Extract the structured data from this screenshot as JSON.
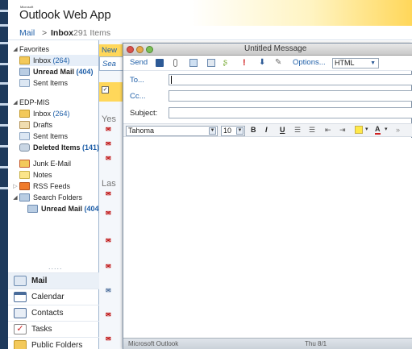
{
  "app": {
    "logo_small": "Microsoft",
    "logo": "Outlook Web App"
  },
  "breadcrumb": {
    "mail": "Mail",
    "sep": ">",
    "folder": "Inbox",
    "count": "291 Items"
  },
  "nav": {
    "favorites_label": "Favorites",
    "favorites": [
      {
        "label": "Inbox",
        "count": "(264)"
      },
      {
        "label": "Unread Mail",
        "count": "(404)"
      },
      {
        "label": "Sent Items",
        "count": ""
      }
    ],
    "account_label": "EDP-MIS",
    "folders": [
      {
        "label": "Inbox",
        "count": "(264)"
      },
      {
        "label": "Drafts",
        "count": ""
      },
      {
        "label": "Sent Items",
        "count": ""
      },
      {
        "label": "Deleted Items",
        "count": "(141)"
      },
      {
        "label": "Junk E-Mail",
        "count": ""
      },
      {
        "label": "Notes",
        "count": ""
      },
      {
        "label": "RSS Feeds",
        "count": ""
      },
      {
        "label": "Search Folders",
        "count": ""
      },
      {
        "label": "Unread Mail",
        "count": "(404)"
      }
    ],
    "dots": ".....",
    "bottom": [
      {
        "label": "Mail"
      },
      {
        "label": "Calendar"
      },
      {
        "label": "Contacts"
      },
      {
        "label": "Tasks"
      },
      {
        "label": "Public Folders"
      }
    ]
  },
  "list": {
    "new_label": "New",
    "search_label": "Sea",
    "group_yesterday": "Yes",
    "group_last": "Las"
  },
  "compose": {
    "title": "Untitled Message",
    "send": "Send",
    "options": "Options...",
    "format": "HTML",
    "to": "To...",
    "cc": "Cc...",
    "subject": "Subject:",
    "font": "Tahoma",
    "size": "10",
    "bold": "B",
    "italic": "I",
    "underline": "U",
    "status_left": "Microsoft Outlook",
    "status_right": "Thu 8/1"
  },
  "colors": {
    "accent": "#1f5fa8",
    "nav_border": "#9fb5cf",
    "header_gold": "#ffd75a"
  }
}
